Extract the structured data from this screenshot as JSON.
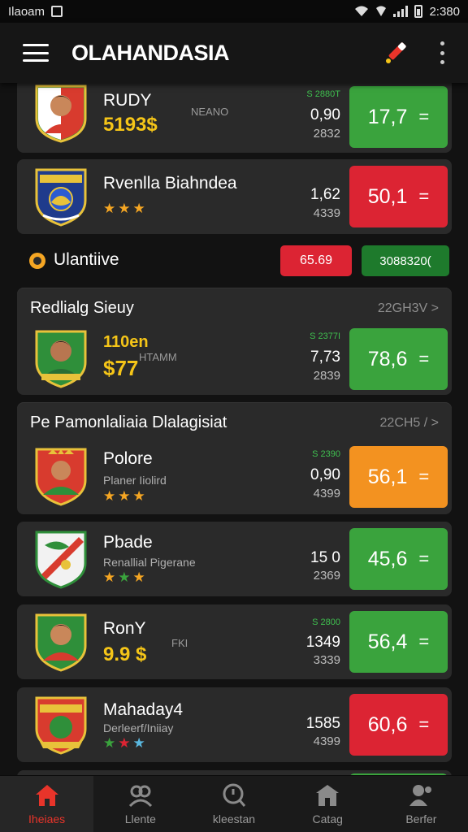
{
  "status_bar": {
    "left_text": "Ilaoam",
    "time": "2:380"
  },
  "app_bar": {
    "title": "OLAHANDASIA",
    "actions": [
      "edit-icon",
      "more-icon"
    ]
  },
  "rows": [
    {
      "name": "RUDY",
      "price": "5193$",
      "sub": "NEANO",
      "tag": "S 2880T",
      "n1": "0,90",
      "n2": "2832",
      "rate": "17,7",
      "rate_color": "#3aa33d"
    },
    {
      "name": "Rvenlla Biahndea",
      "stars": "★★★",
      "n1": "1,62",
      "n2": "4339",
      "rate": "50,1",
      "rate_color": "#dc2433"
    }
  ],
  "banner": {
    "label": "Ulantiive",
    "left_value": "65.69",
    "right_value": "3088320("
  },
  "section1": {
    "title": "Redlialg Sieuy",
    "link": "22GH3V >",
    "row": {
      "name": "110en",
      "price": "$77",
      "sub": "HTAMM",
      "tag": "S 2377I",
      "n1": "7,73",
      "n2": "2839",
      "rate": "78,6",
      "rate_color": "#3aa33d"
    }
  },
  "section2": {
    "title": "Pe Pamonlaliaia Dlalagisiat",
    "link": "22CH5 / >",
    "rows": [
      {
        "name": "Polore",
        "sub": "Planer Iiolird",
        "stars": "★★★",
        "tag": "S 2390",
        "n1": "0,90",
        "n2": "4399",
        "rate": "56,1",
        "rate_color": "#f39220"
      },
      {
        "name": "Pbade",
        "sub": "Renallial Pigerane",
        "stars": "★★★",
        "n1": "15 0",
        "n2": "2369",
        "rate": "45,6",
        "rate_color": "#3aa33d"
      },
      {
        "name": "RonY",
        "price": "9.9 $",
        "sub": "FKI",
        "tag": "S 2800",
        "n1": "1349",
        "n2": "3339",
        "rate": "56,4",
        "rate_color": "#3aa33d"
      },
      {
        "name": "Mahaday4",
        "sub": "Derleerf/Iniiay",
        "stars": "★★★",
        "n1": "1585",
        "n2": "4399",
        "rate": "60,6",
        "rate_color": "#dc2433"
      }
    ]
  },
  "bottom_nav": [
    {
      "label": "Iheiaes",
      "icon": "home-icon",
      "active": true
    },
    {
      "label": "Llente",
      "icon": "players-icon",
      "active": false
    },
    {
      "label": "kleestan",
      "icon": "search-icon",
      "active": false
    },
    {
      "label": "Catag",
      "icon": "store-icon",
      "active": false
    },
    {
      "label": "Berfer",
      "icon": "profile-icon",
      "active": false
    }
  ],
  "colors": {
    "green": "#3aa33d",
    "red": "#dc2433",
    "orange": "#f39220",
    "accent": "#f5c518",
    "nav_active": "#e8342a"
  }
}
